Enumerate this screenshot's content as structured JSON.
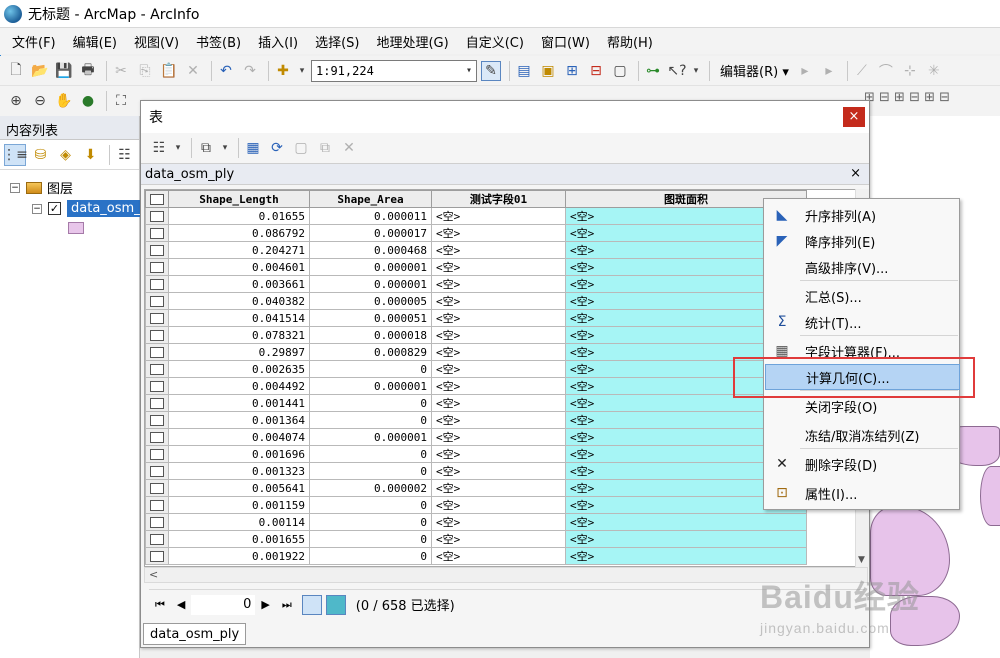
{
  "window": {
    "title": "无标题 - ArcMap - ArcInfo"
  },
  "menu": [
    "文件(F)",
    "编辑(E)",
    "视图(V)",
    "书签(B)",
    "插入(I)",
    "选择(S)",
    "地理处理(G)",
    "自定义(C)",
    "窗口(W)",
    "帮助(H)"
  ],
  "toolbar": {
    "scale_value": "1:91,224",
    "editor_label": "编辑器(R)"
  },
  "toc": {
    "header": "内容列表",
    "layers_group": "图层",
    "layer_name": "data_osm_",
    "layer_checked": "✓"
  },
  "table_window": {
    "title": "表",
    "close": "×",
    "tab_name": "data_osm_ply",
    "tab_close": "×",
    "bottom_tab": "data_osm_ply",
    "record_value": "0",
    "selection_status": "(0 / 658 已选择)"
  },
  "grid": {
    "columns": [
      "Shape_Length",
      "Shape_Area",
      "测试字段01",
      "图斑面积"
    ],
    "rows": [
      [
        "0.01655",
        "0.000011",
        "<空>",
        "<空>"
      ],
      [
        "0.086792",
        "0.000017",
        "<空>",
        "<空>"
      ],
      [
        "0.204271",
        "0.000468",
        "<空>",
        "<空>"
      ],
      [
        "0.004601",
        "0.000001",
        "<空>",
        "<空>"
      ],
      [
        "0.003661",
        "0.000001",
        "<空>",
        "<空>"
      ],
      [
        "0.040382",
        "0.000005",
        "<空>",
        "<空>"
      ],
      [
        "0.041514",
        "0.000051",
        "<空>",
        "<空>"
      ],
      [
        "0.078321",
        "0.000018",
        "<空>",
        "<空>"
      ],
      [
        "0.29897",
        "0.000829",
        "<空>",
        "<空>"
      ],
      [
        "0.002635",
        "0",
        "<空>",
        "<空>"
      ],
      [
        "0.004492",
        "0.000001",
        "<空>",
        "<空>"
      ],
      [
        "0.001441",
        "0",
        "<空>",
        "<空>"
      ],
      [
        "0.001364",
        "0",
        "<空>",
        "<空>"
      ],
      [
        "0.004074",
        "0.000001",
        "<空>",
        "<空>"
      ],
      [
        "0.001696",
        "0",
        "<空>",
        "<空>"
      ],
      [
        "0.001323",
        "0",
        "<空>",
        "<空>"
      ],
      [
        "0.005641",
        "0.000002",
        "<空>",
        "<空>"
      ],
      [
        "0.001159",
        "0",
        "<空>",
        "<空>"
      ],
      [
        "0.00114",
        "0",
        "<空>",
        "<空>"
      ],
      [
        "0.001655",
        "0",
        "<空>",
        "<空>"
      ],
      [
        "0.001922",
        "0",
        "<空>",
        "<空>"
      ]
    ]
  },
  "context_menu": {
    "items": [
      {
        "label": "升序排列(A)",
        "icon": "sort-ascending-icon"
      },
      {
        "label": "降序排列(E)",
        "icon": "sort-descending-icon"
      },
      {
        "label": "高级排序(V)...",
        "icon": ""
      },
      {
        "label": "汇总(S)...",
        "icon": ""
      },
      {
        "label": "统计(T)...",
        "icon": "sigma-icon"
      },
      {
        "label": "字段计算器(F)...",
        "icon": "calculator-icon"
      },
      {
        "label": "计算几何(C)...",
        "icon": ""
      },
      {
        "label": "关闭字段(O)",
        "icon": ""
      },
      {
        "label": "冻结/取消冻结列(Z)",
        "icon": ""
      },
      {
        "label": "删除字段(D)",
        "icon": "delete-x-icon"
      },
      {
        "label": "属性(I)...",
        "icon": "properties-icon"
      }
    ],
    "highlighted": "计算几何(C)..."
  },
  "colors": {
    "highlight_column": "#a6f5f5",
    "menu_highlight": "#b5d4f4",
    "callout_red": "#e03b3b",
    "layer_fill": "#e8c6ea"
  },
  "watermark": {
    "main": "Baidu经验",
    "sub": "jingyan.baidu.com"
  }
}
